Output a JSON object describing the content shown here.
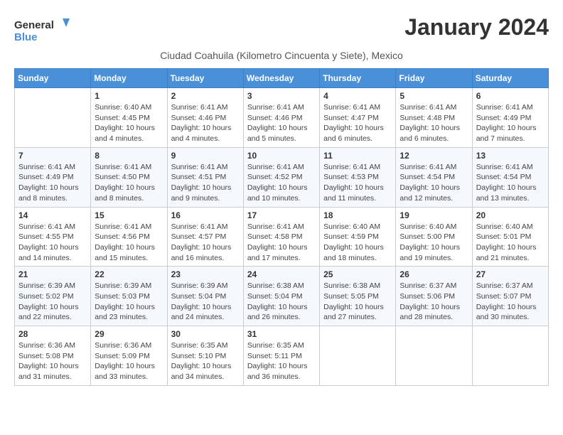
{
  "logo": {
    "text_general": "General",
    "text_blue": "Blue"
  },
  "header": {
    "month_title": "January 2024",
    "subtitle": "Ciudad Coahuila (Kilometro Cincuenta y Siete), Mexico"
  },
  "weekdays": [
    "Sunday",
    "Monday",
    "Tuesday",
    "Wednesday",
    "Thursday",
    "Friday",
    "Saturday"
  ],
  "weeks": [
    [
      {
        "day": "",
        "info": ""
      },
      {
        "day": "1",
        "info": "Sunrise: 6:40 AM\nSunset: 4:45 PM\nDaylight: 10 hours\nand 4 minutes."
      },
      {
        "day": "2",
        "info": "Sunrise: 6:41 AM\nSunset: 4:46 PM\nDaylight: 10 hours\nand 4 minutes."
      },
      {
        "day": "3",
        "info": "Sunrise: 6:41 AM\nSunset: 4:46 PM\nDaylight: 10 hours\nand 5 minutes."
      },
      {
        "day": "4",
        "info": "Sunrise: 6:41 AM\nSunset: 4:47 PM\nDaylight: 10 hours\nand 6 minutes."
      },
      {
        "day": "5",
        "info": "Sunrise: 6:41 AM\nSunset: 4:48 PM\nDaylight: 10 hours\nand 6 minutes."
      },
      {
        "day": "6",
        "info": "Sunrise: 6:41 AM\nSunset: 4:49 PM\nDaylight: 10 hours\nand 7 minutes."
      }
    ],
    [
      {
        "day": "7",
        "info": "Sunrise: 6:41 AM\nSunset: 4:49 PM\nDaylight: 10 hours\nand 8 minutes."
      },
      {
        "day": "8",
        "info": "Sunrise: 6:41 AM\nSunset: 4:50 PM\nDaylight: 10 hours\nand 8 minutes."
      },
      {
        "day": "9",
        "info": "Sunrise: 6:41 AM\nSunset: 4:51 PM\nDaylight: 10 hours\nand 9 minutes."
      },
      {
        "day": "10",
        "info": "Sunrise: 6:41 AM\nSunset: 4:52 PM\nDaylight: 10 hours\nand 10 minutes."
      },
      {
        "day": "11",
        "info": "Sunrise: 6:41 AM\nSunset: 4:53 PM\nDaylight: 10 hours\nand 11 minutes."
      },
      {
        "day": "12",
        "info": "Sunrise: 6:41 AM\nSunset: 4:54 PM\nDaylight: 10 hours\nand 12 minutes."
      },
      {
        "day": "13",
        "info": "Sunrise: 6:41 AM\nSunset: 4:54 PM\nDaylight: 10 hours\nand 13 minutes."
      }
    ],
    [
      {
        "day": "14",
        "info": "Sunrise: 6:41 AM\nSunset: 4:55 PM\nDaylight: 10 hours\nand 14 minutes."
      },
      {
        "day": "15",
        "info": "Sunrise: 6:41 AM\nSunset: 4:56 PM\nDaylight: 10 hours\nand 15 minutes."
      },
      {
        "day": "16",
        "info": "Sunrise: 6:41 AM\nSunset: 4:57 PM\nDaylight: 10 hours\nand 16 minutes."
      },
      {
        "day": "17",
        "info": "Sunrise: 6:41 AM\nSunset: 4:58 PM\nDaylight: 10 hours\nand 17 minutes."
      },
      {
        "day": "18",
        "info": "Sunrise: 6:40 AM\nSunset: 4:59 PM\nDaylight: 10 hours\nand 18 minutes."
      },
      {
        "day": "19",
        "info": "Sunrise: 6:40 AM\nSunset: 5:00 PM\nDaylight: 10 hours\nand 19 minutes."
      },
      {
        "day": "20",
        "info": "Sunrise: 6:40 AM\nSunset: 5:01 PM\nDaylight: 10 hours\nand 21 minutes."
      }
    ],
    [
      {
        "day": "21",
        "info": "Sunrise: 6:39 AM\nSunset: 5:02 PM\nDaylight: 10 hours\nand 22 minutes."
      },
      {
        "day": "22",
        "info": "Sunrise: 6:39 AM\nSunset: 5:03 PM\nDaylight: 10 hours\nand 23 minutes."
      },
      {
        "day": "23",
        "info": "Sunrise: 6:39 AM\nSunset: 5:04 PM\nDaylight: 10 hours\nand 24 minutes."
      },
      {
        "day": "24",
        "info": "Sunrise: 6:38 AM\nSunset: 5:04 PM\nDaylight: 10 hours\nand 26 minutes."
      },
      {
        "day": "25",
        "info": "Sunrise: 6:38 AM\nSunset: 5:05 PM\nDaylight: 10 hours\nand 27 minutes."
      },
      {
        "day": "26",
        "info": "Sunrise: 6:37 AM\nSunset: 5:06 PM\nDaylight: 10 hours\nand 28 minutes."
      },
      {
        "day": "27",
        "info": "Sunrise: 6:37 AM\nSunset: 5:07 PM\nDaylight: 10 hours\nand 30 minutes."
      }
    ],
    [
      {
        "day": "28",
        "info": "Sunrise: 6:36 AM\nSunset: 5:08 PM\nDaylight: 10 hours\nand 31 minutes."
      },
      {
        "day": "29",
        "info": "Sunrise: 6:36 AM\nSunset: 5:09 PM\nDaylight: 10 hours\nand 33 minutes."
      },
      {
        "day": "30",
        "info": "Sunrise: 6:35 AM\nSunset: 5:10 PM\nDaylight: 10 hours\nand 34 minutes."
      },
      {
        "day": "31",
        "info": "Sunrise: 6:35 AM\nSunset: 5:11 PM\nDaylight: 10 hours\nand 36 minutes."
      },
      {
        "day": "",
        "info": ""
      },
      {
        "day": "",
        "info": ""
      },
      {
        "day": "",
        "info": ""
      }
    ]
  ]
}
